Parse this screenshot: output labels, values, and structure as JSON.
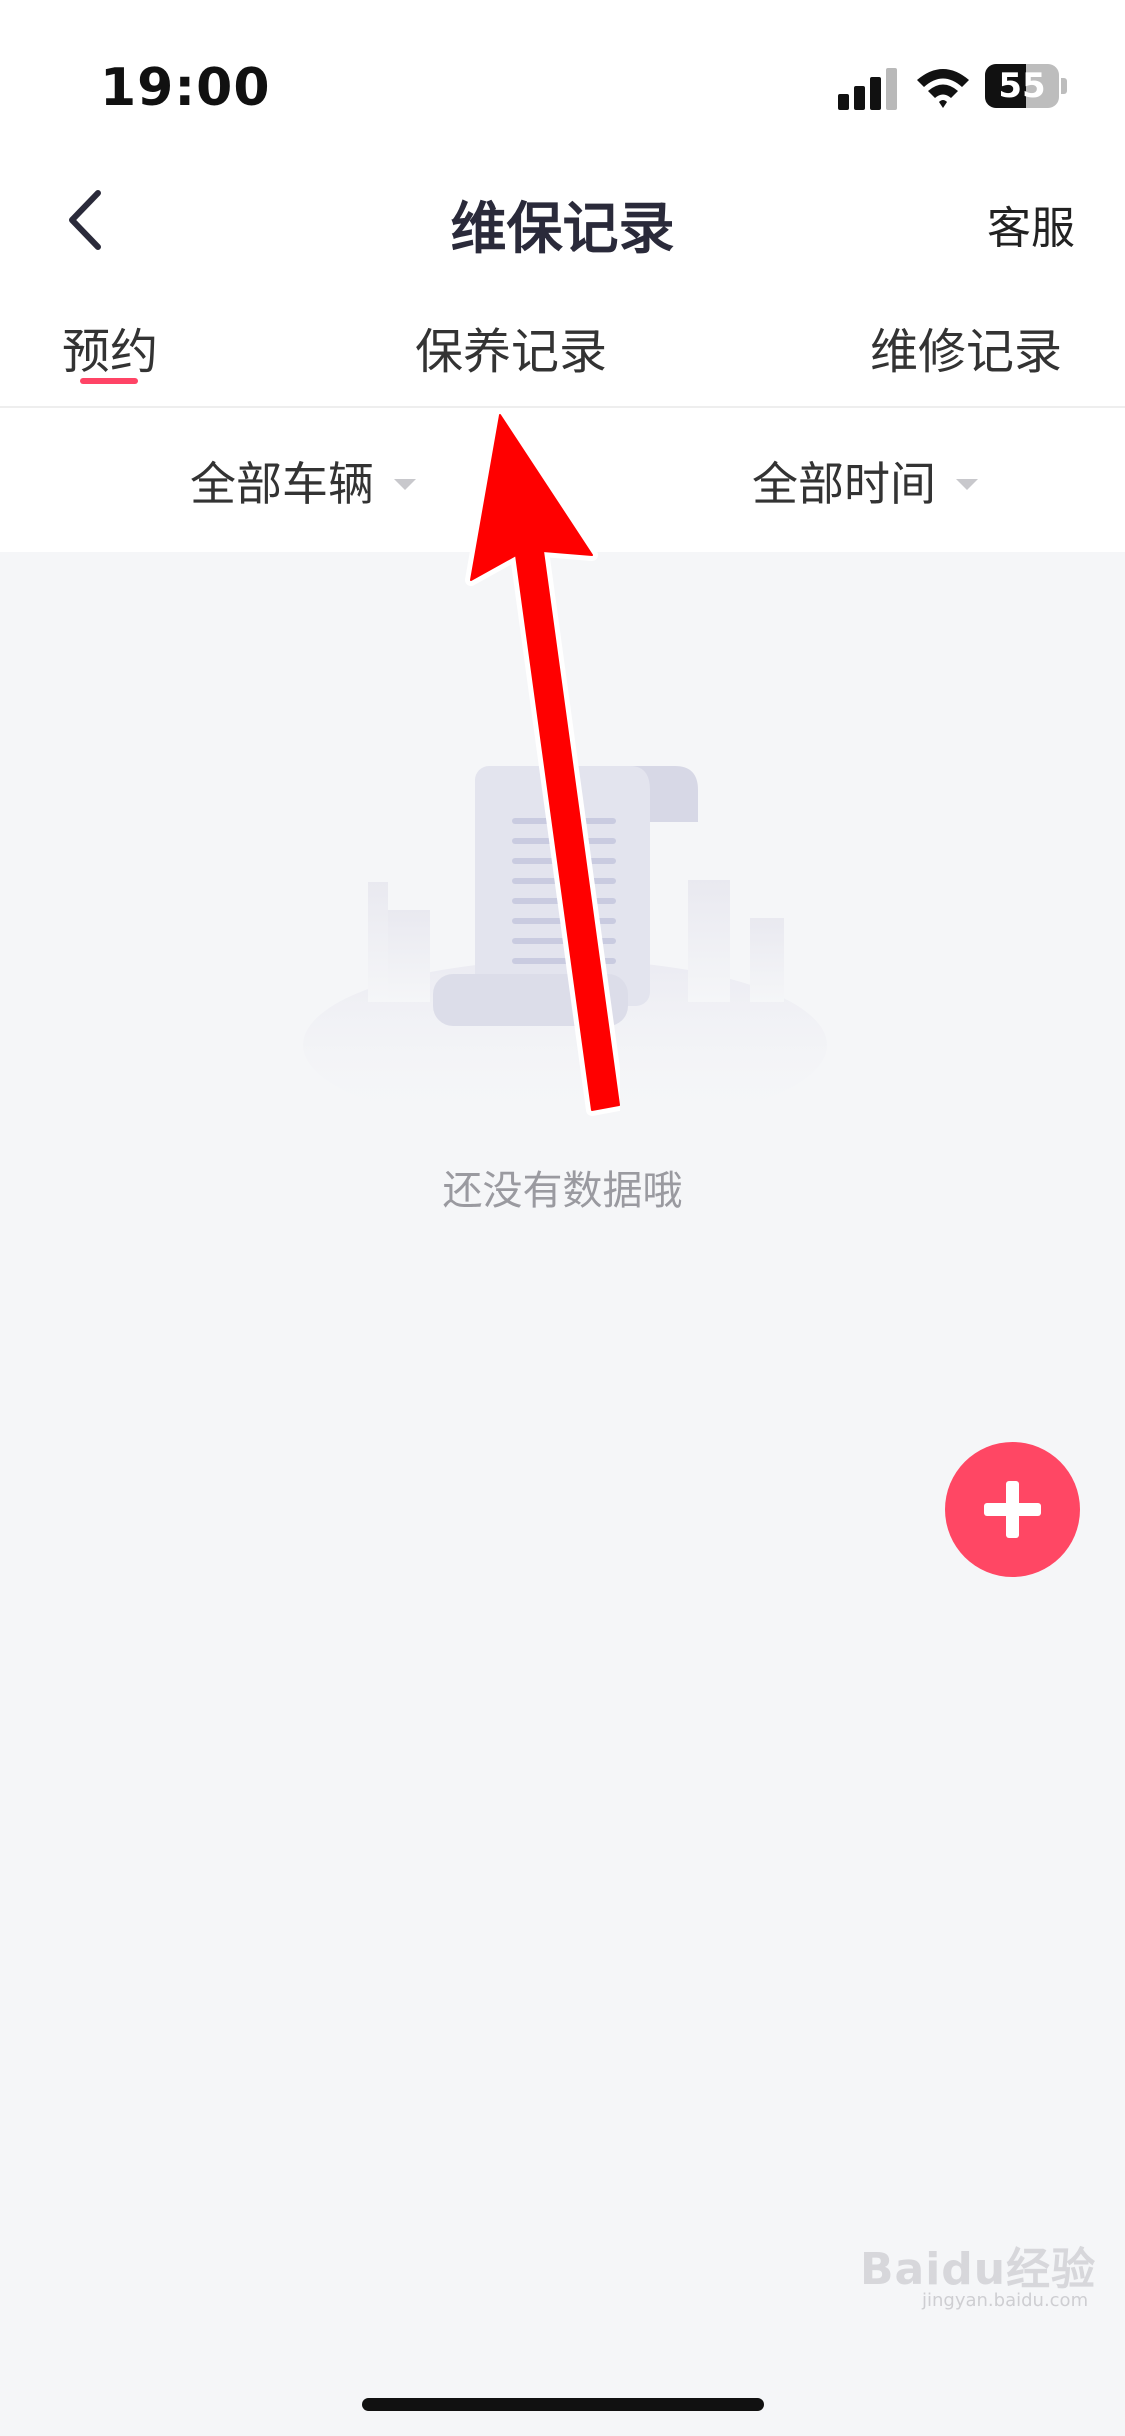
{
  "status_bar": {
    "time": "19:00",
    "battery_level": "55",
    "battery_fraction": 0.55
  },
  "nav": {
    "title": "维保记录",
    "back_icon": "chevron-left-icon",
    "right_action": "客服"
  },
  "tabs": [
    {
      "label": "预约",
      "active": true
    },
    {
      "label": "保养记录",
      "active": false
    },
    {
      "label": "维修记录",
      "active": false
    }
  ],
  "filters": [
    {
      "label": "全部车辆",
      "icon": "caret-down-icon"
    },
    {
      "label": "全部时间",
      "icon": "caret-down-icon"
    }
  ],
  "empty_state": {
    "message": "还没有数据哦",
    "illustration": "document-icon"
  },
  "fab": {
    "icon": "plus-icon"
  },
  "annotation": {
    "icon": "red-arrow-annotation",
    "color": "#ff0000"
  },
  "watermark": {
    "text": "Baidu经验",
    "sub": "jingyan.baidu.com"
  },
  "colors": {
    "accent": "#ff4764",
    "tab_indicator": "#ff4466",
    "background": "#f5f6f8"
  }
}
